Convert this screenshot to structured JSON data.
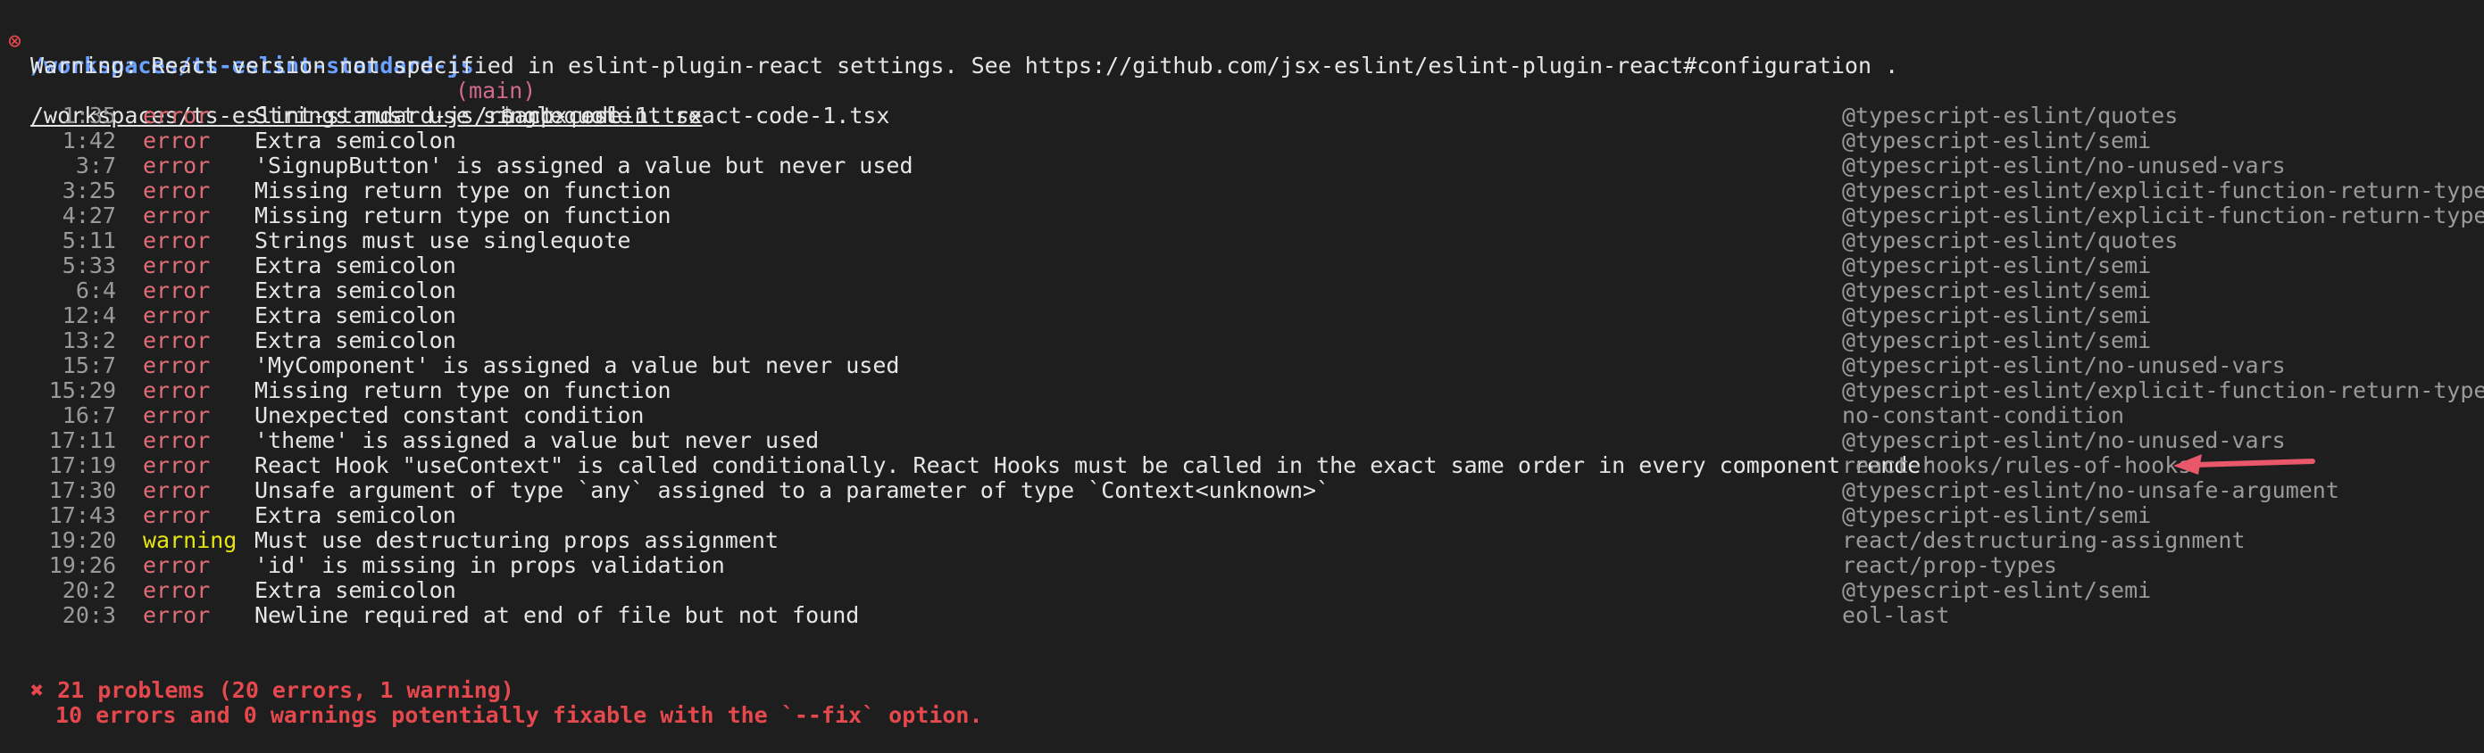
{
  "prompt": {
    "error_mark": "⊗",
    "path": "/workspaces/ts-eslint-standard-js",
    "branch": "(main)",
    "command": "$ npx eslint react-code-1.tsx"
  },
  "warning_text": "Warning: React version not specified in eslint-plugin-react settings. See https://github.com/jsx-eslint/eslint-plugin-react#configuration .",
  "file_header": "/workspaces/ts-eslint-standard-js/react-code-1.tsx",
  "rows": [
    {
      "loc": "1:35",
      "severity": "error",
      "message": "Strings must use singlequote",
      "rule": "@typescript-eslint/quotes"
    },
    {
      "loc": "1:42",
      "severity": "error",
      "message": "Extra semicolon",
      "rule": "@typescript-eslint/semi"
    },
    {
      "loc": "3:7",
      "severity": "error",
      "message": "'SignupButton' is assigned a value but never used",
      "rule": "@typescript-eslint/no-unused-vars"
    },
    {
      "loc": "3:25",
      "severity": "error",
      "message": "Missing return type on function",
      "rule": "@typescript-eslint/explicit-function-return-type"
    },
    {
      "loc": "4:27",
      "severity": "error",
      "message": "Missing return type on function",
      "rule": "@typescript-eslint/explicit-function-return-type"
    },
    {
      "loc": "5:11",
      "severity": "error",
      "message": "Strings must use singlequote",
      "rule": "@typescript-eslint/quotes"
    },
    {
      "loc": "5:33",
      "severity": "error",
      "message": "Extra semicolon",
      "rule": "@typescript-eslint/semi"
    },
    {
      "loc": "6:4",
      "severity": "error",
      "message": "Extra semicolon",
      "rule": "@typescript-eslint/semi"
    },
    {
      "loc": "12:4",
      "severity": "error",
      "message": "Extra semicolon",
      "rule": "@typescript-eslint/semi"
    },
    {
      "loc": "13:2",
      "severity": "error",
      "message": "Extra semicolon",
      "rule": "@typescript-eslint/semi"
    },
    {
      "loc": "15:7",
      "severity": "error",
      "message": "'MyComponent' is assigned a value but never used",
      "rule": "@typescript-eslint/no-unused-vars"
    },
    {
      "loc": "15:29",
      "severity": "error",
      "message": "Missing return type on function",
      "rule": "@typescript-eslint/explicit-function-return-type"
    },
    {
      "loc": "16:7",
      "severity": "error",
      "message": "Unexpected constant condition",
      "rule": "no-constant-condition"
    },
    {
      "loc": "17:11",
      "severity": "error",
      "message": "'theme' is assigned a value but never used",
      "rule": "@typescript-eslint/no-unused-vars"
    },
    {
      "loc": "17:19",
      "severity": "error",
      "message": "React Hook \"useContext\" is called conditionally. React Hooks must be called in the exact same order in every component render",
      "rule": "react-hooks/rules-of-hooks"
    },
    {
      "loc": "17:30",
      "severity": "error",
      "message": "Unsafe argument of type `any` assigned to a parameter of type `Context<unknown>`",
      "rule": "@typescript-eslint/no-unsafe-argument"
    },
    {
      "loc": "17:43",
      "severity": "error",
      "message": "Extra semicolon",
      "rule": "@typescript-eslint/semi"
    },
    {
      "loc": "19:20",
      "severity": "warning",
      "message": "Must use destructuring props assignment",
      "rule": "react/destructuring-assignment"
    },
    {
      "loc": "19:26",
      "severity": "error",
      "message": "'id' is missing in props validation",
      "rule": "react/prop-types"
    },
    {
      "loc": "20:2",
      "severity": "error",
      "message": "Extra semicolon",
      "rule": "@typescript-eslint/semi"
    },
    {
      "loc": "20:3",
      "severity": "error",
      "message": "Newline required at end of file but not found",
      "rule": "eol-last"
    }
  ],
  "summary": {
    "problems": "✖ 21 problems (20 errors, 1 warning)",
    "fixable": "10 errors and 0 warnings potentially fixable with the `--fix` option."
  },
  "colors": {
    "background": "#1e1e1e",
    "error": "#e06c75",
    "warning": "#e5e510",
    "path": "#6aa0ff",
    "arrow": "#e8576a"
  },
  "annotation_icon": "red-arrow-icon"
}
